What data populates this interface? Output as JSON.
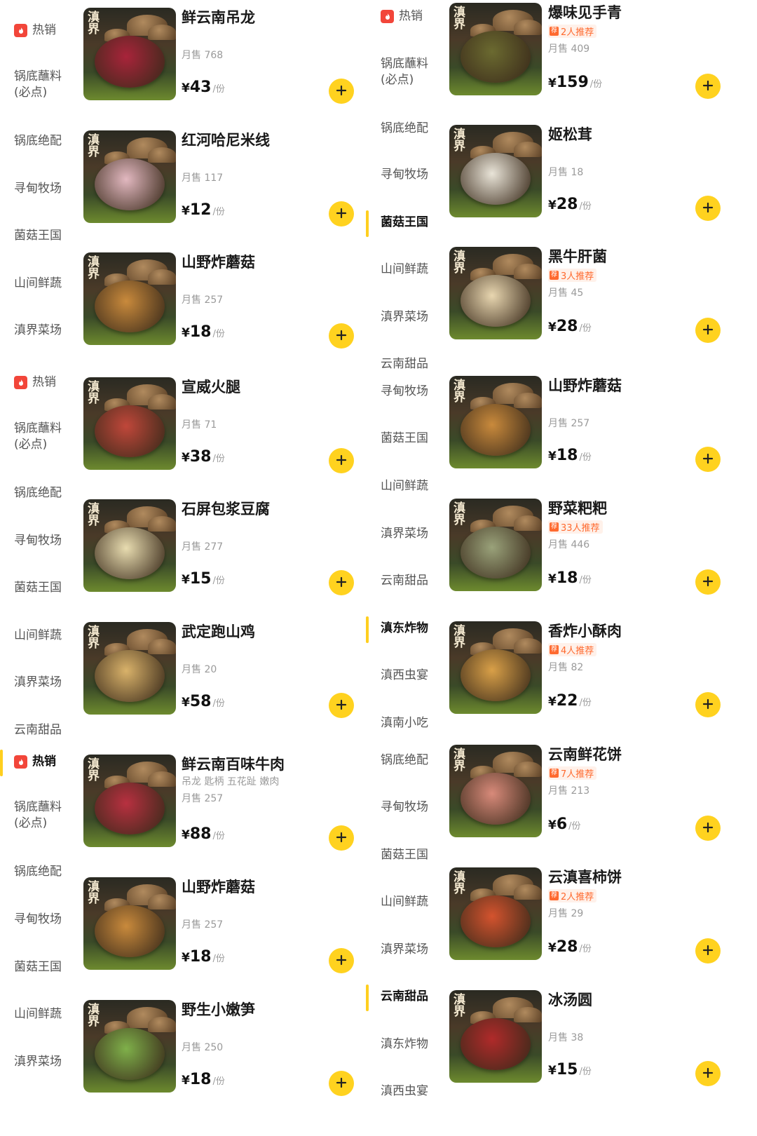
{
  "hot_label": "热销",
  "price_unit": "/份",
  "price_symbol": "¥",
  "colors": {
    "accent": "#ffd21f",
    "hot": "#f2463a",
    "recommend": "#ff6a2f"
  },
  "nav_left": [
    {
      "label": "热销",
      "hot": true,
      "active": false
    },
    {
      "label": "锅底蘸料\n(必点)"
    },
    {
      "label": "锅底绝配"
    },
    {
      "label": "寻甸牧场"
    },
    {
      "label": "菌菇王国"
    },
    {
      "label": "山间鲜蔬"
    },
    {
      "label": "滇界菜场"
    },
    {
      "label": "热销",
      "hot": true,
      "active": false
    },
    {
      "label": "锅底蘸料\n(必点)"
    },
    {
      "label": "锅底绝配"
    },
    {
      "label": "寻甸牧场"
    },
    {
      "label": "菌菇王国"
    },
    {
      "label": "山间鲜蔬"
    },
    {
      "label": "滇界菜场"
    },
    {
      "label": "云南甜品"
    },
    {
      "label": "热销",
      "hot": true,
      "active": true
    },
    {
      "label": "锅底蘸料\n(必点)"
    },
    {
      "label": "锅底绝配"
    },
    {
      "label": "寻甸牧场"
    },
    {
      "label": "菌菇王国"
    },
    {
      "label": "山间鲜蔬"
    },
    {
      "label": "滇界菜场"
    }
  ],
  "nav_right": [
    {
      "label": "热销",
      "hot": true
    },
    {
      "label": "锅底蘸料\n(必点)"
    },
    {
      "label": "锅底绝配"
    },
    {
      "label": "寻甸牧场"
    },
    {
      "label": "菌菇王国",
      "active": true
    },
    {
      "label": "山间鲜蔬"
    },
    {
      "label": "滇界菜场"
    },
    {
      "label": "云南甜品"
    },
    {
      "label": "寻甸牧场"
    },
    {
      "label": "菌菇王国"
    },
    {
      "label": "山间鲜蔬"
    },
    {
      "label": "滇界菜场"
    },
    {
      "label": "云南甜品"
    },
    {
      "label": "滇东炸物",
      "active": true
    },
    {
      "label": "滇西虫宴"
    },
    {
      "label": "滇南小吃"
    },
    {
      "label": "锅底绝配"
    },
    {
      "label": "寻甸牧场"
    },
    {
      "label": "菌菇王国"
    },
    {
      "label": "山间鲜蔬"
    },
    {
      "label": "滇界菜场"
    },
    {
      "label": "云南甜品",
      "active": true
    },
    {
      "label": "滇东炸物"
    },
    {
      "label": "滇西虫宴"
    }
  ],
  "items_left": [
    {
      "name": "鲜云南吊龙",
      "sales": "月售 768",
      "price": "43",
      "dish": "#a8243a"
    },
    {
      "name": "红河哈尼米线",
      "sales": "月售 117",
      "price": "12",
      "dish": "#e2b8c0"
    },
    {
      "name": "山野炸蘑菇",
      "sales": "月售 257",
      "price": "18",
      "dish": "#c98a3c"
    },
    {
      "name": "宣威火腿",
      "sales": "月售 71",
      "price": "38",
      "dish": "#c0473a"
    },
    {
      "name": "石屏包浆豆腐",
      "sales": "月售 277",
      "price": "15",
      "dish": "#e8dcb0"
    },
    {
      "name": "武定跑山鸡",
      "sales": "月售 20",
      "price": "58",
      "dish": "#d9b26a"
    },
    {
      "name": "鲜云南百味牛肉",
      "desc": "吊龙 匙柄 五花趾 嫩肉",
      "sales": "月售 257",
      "price": "88",
      "dish": "#b83040"
    },
    {
      "name": "山野炸蘑菇",
      "sales": "月售 257",
      "price": "18",
      "dish": "#c98a3c"
    },
    {
      "name": "野生小嫩笋",
      "sales": "月售 250",
      "price": "18",
      "dish": "#7fb04a"
    }
  ],
  "items_right": [
    {
      "name": "爆味见手青",
      "rec": "2人推荐",
      "sales": "月售 409",
      "price": "159",
      "dish": "#6b6a30"
    },
    {
      "name": "姬松茸",
      "sales": "月售 18",
      "price": "28",
      "dish": "#e9e4d8"
    },
    {
      "name": "黑牛肝菌",
      "rec": "3人推荐",
      "sales": "月售 45",
      "price": "28",
      "dish": "#e8d6b0"
    },
    {
      "name": "山野炸蘑菇",
      "sales": "月售 257",
      "price": "18",
      "dish": "#c98a3c"
    },
    {
      "name": "野菜粑粑",
      "rec": "33人推荐",
      "sales": "月售 446",
      "price": "18",
      "dish": "#9aa27a"
    },
    {
      "name": "香炸小酥肉",
      "rec": "4人推荐",
      "sales": "月售 82",
      "price": "22",
      "dish": "#d9a048"
    },
    {
      "name": "云南鲜花饼",
      "rec": "7人推荐",
      "sales": "月售 213",
      "price": "6",
      "dish": "#d88a7a"
    },
    {
      "name": "云滇喜柿饼",
      "rec": "2人推荐",
      "sales": "月售 29",
      "price": "28",
      "dish": "#d4532e"
    },
    {
      "name": "冰汤圆",
      "sales": "月售 38",
      "price": "15",
      "dish": "#b02a2a"
    }
  ]
}
